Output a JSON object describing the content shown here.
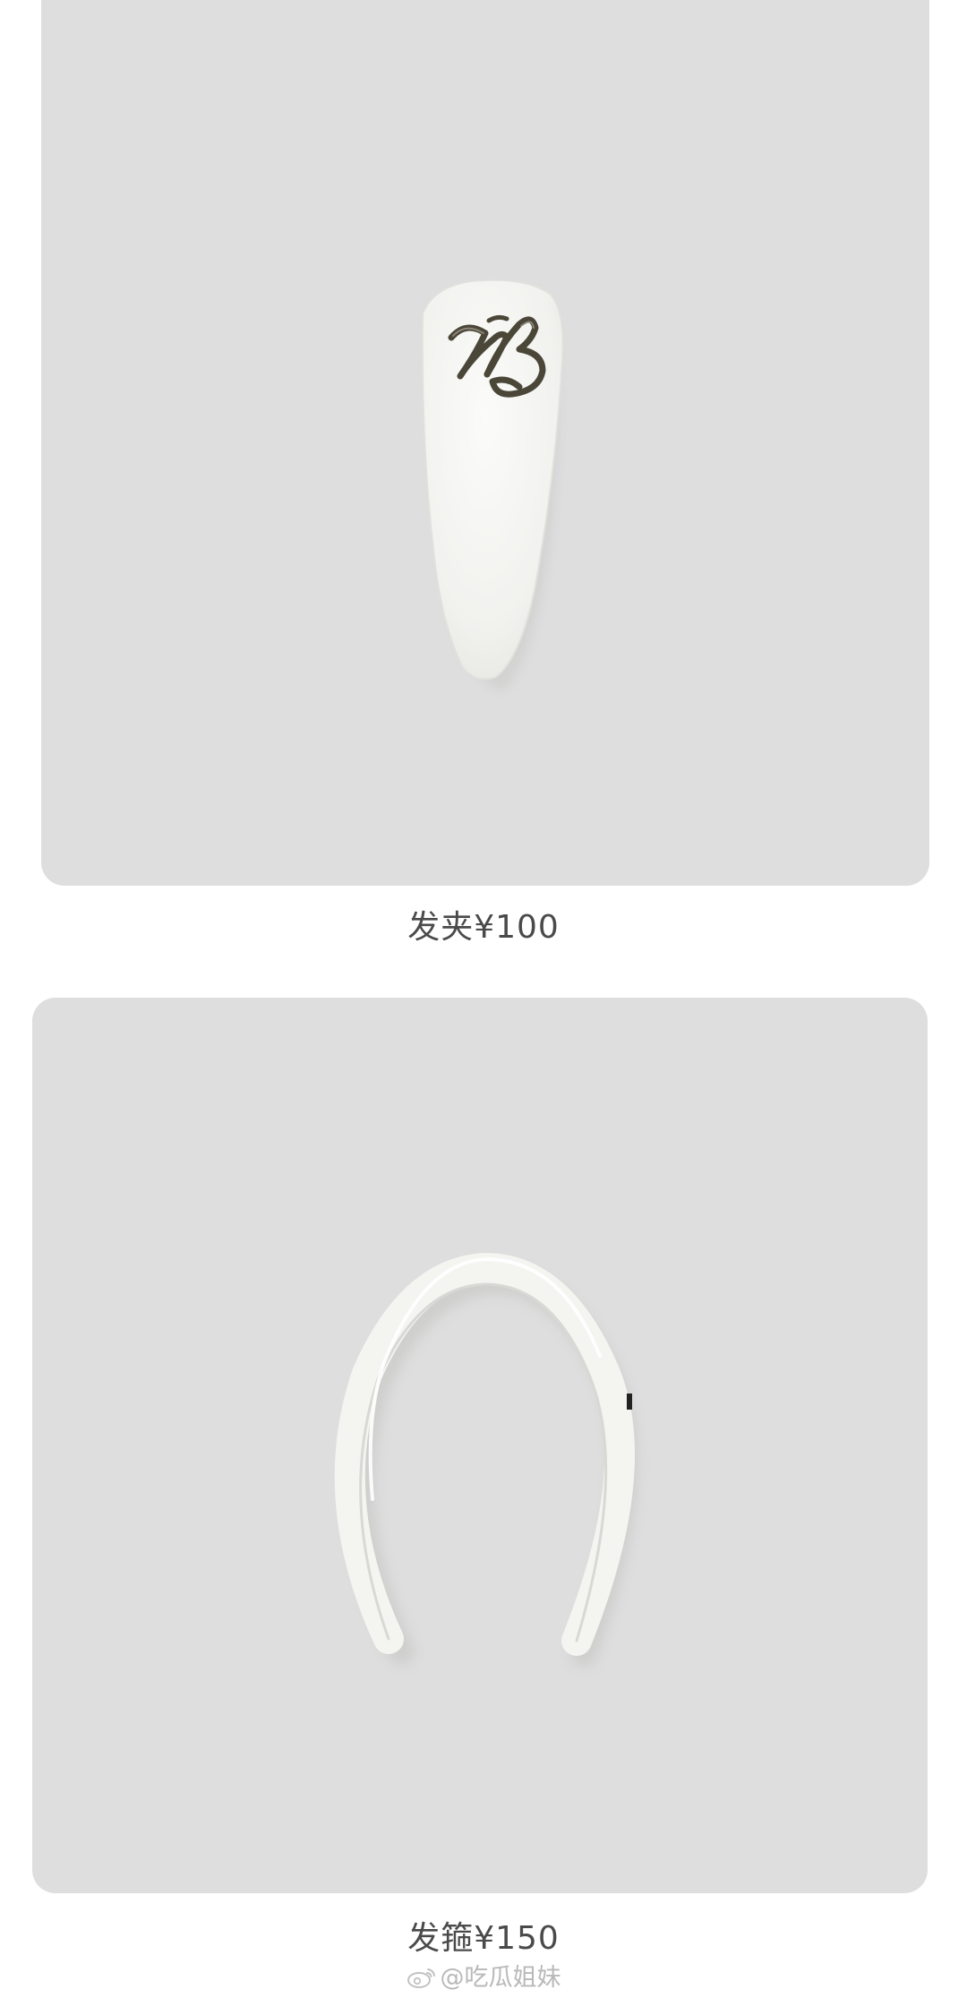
{
  "products": [
    {
      "name": "hair-clip",
      "caption": "发夹¥100",
      "logo_text": "MB"
    },
    {
      "name": "headband",
      "caption": "发箍¥150"
    }
  ],
  "watermark": {
    "text": "@吃瓜姐妹",
    "icon": "weibo-icon"
  },
  "colors": {
    "background": "#ffffff",
    "card": "#dededf",
    "product_white": "#f6f6f3",
    "logo_metal": "#4a4638",
    "caption_text": "#4a4a4a",
    "watermark_text": "#b9b9b9"
  }
}
